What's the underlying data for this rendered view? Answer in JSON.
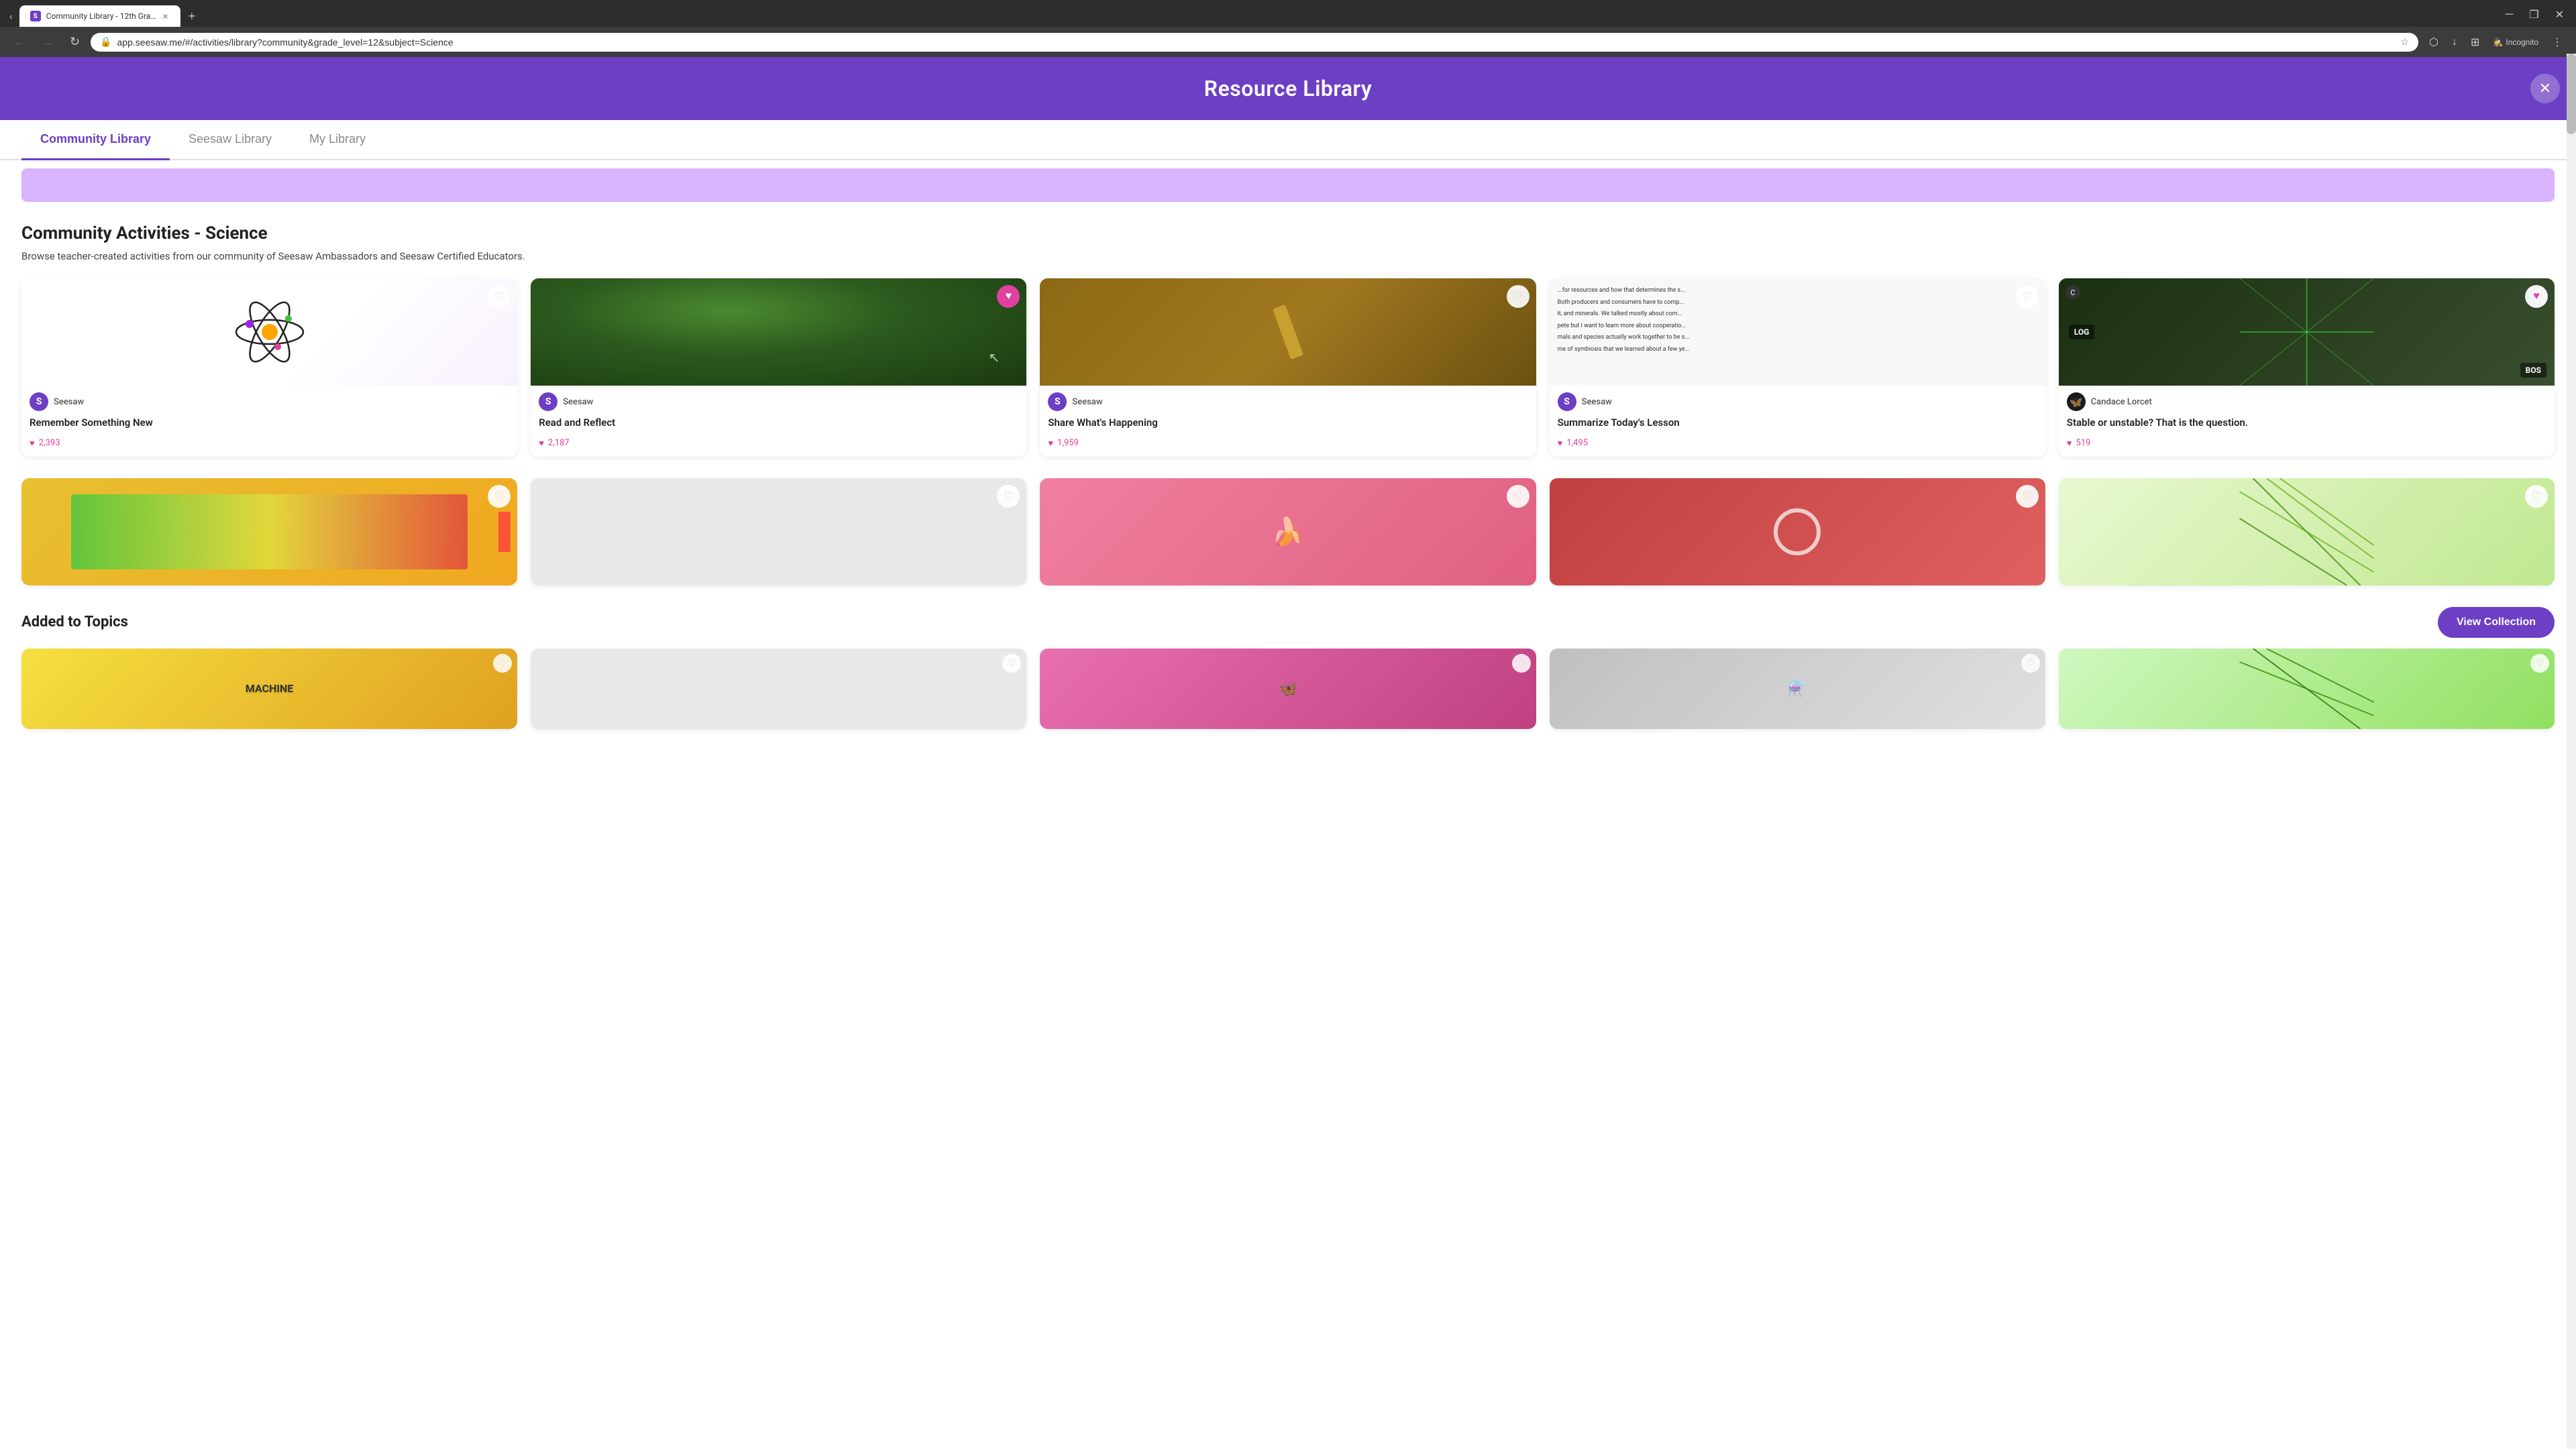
{
  "browser": {
    "tab": {
      "favicon": "S",
      "title": "Community Library - 12th Grad...",
      "close_label": "×"
    },
    "new_tab_label": "+",
    "window_controls": {
      "minimize": "─",
      "maximize": "❐",
      "close": "✕"
    },
    "nav": {
      "back": "←",
      "forward": "→",
      "refresh": "↻"
    },
    "address": "app.seesaw.me/#/activities/library?community&grade_level=12&subject=Science",
    "toolbar": {
      "bookmark": "☆",
      "extensions": "⬡",
      "downloads": "↓",
      "tab_layout": "⊞",
      "profile": "👤",
      "incognito": "Incognito",
      "menu": "⋮"
    }
  },
  "header": {
    "title": "Resource Library",
    "close_label": "✕"
  },
  "tabs": [
    {
      "id": "community",
      "label": "Community Library",
      "active": true
    },
    {
      "id": "seesaw",
      "label": "Seesaw Library",
      "active": false
    },
    {
      "id": "my",
      "label": "My Library",
      "active": false
    }
  ],
  "section": {
    "title": "Community Activities - Science",
    "description": "Browse teacher-created activities from our community of Seesaw Ambassadors and Seesaw Certified Educators."
  },
  "activities": [
    {
      "id": "remember-something-new",
      "author": "Seesaw",
      "author_initial": "S",
      "title": "Remember Something New",
      "likes": "2,393",
      "liked": false,
      "img_type": "atom"
    },
    {
      "id": "read-and-reflect",
      "author": "Seesaw",
      "author_initial": "S",
      "title": "Read and Reflect",
      "likes": "2,187",
      "liked": true,
      "img_type": "plant",
      "hovering": true
    },
    {
      "id": "share-whats-happening",
      "author": "Seesaw",
      "author_initial": "S",
      "title": "Share What's Happening",
      "likes": "1,959",
      "liked": false,
      "img_type": "lab"
    },
    {
      "id": "summarize-todays-lesson",
      "author": "Seesaw",
      "author_initial": "S",
      "title": "Summarize Today's Lesson",
      "likes": "1,495",
      "liked": false,
      "img_type": "text"
    },
    {
      "id": "stable-or-unstable",
      "author": "Candace Lorcet",
      "author_initial": "C",
      "title": "Stable or unstable? That is the question.",
      "likes": "519",
      "liked": true,
      "img_type": "sports"
    }
  ],
  "second_row_cards": [
    {
      "img_type": "yellow",
      "has_heart": true,
      "has_badge": true
    },
    {
      "img_type": "empty",
      "has_heart": true
    },
    {
      "img_type": "pink",
      "has_heart": true
    },
    {
      "img_type": "circuit",
      "has_heart": true
    },
    {
      "img_type": "lines",
      "has_heart": true
    }
  ],
  "added_section": {
    "title": "Added to Topics",
    "view_collection_label": "View Collection"
  },
  "bottom_cards": [
    {
      "img_type": "machine",
      "label": "MACHINE"
    },
    {
      "img_type": "empty"
    },
    {
      "img_type": "pink2"
    },
    {
      "img_type": "circuit2"
    },
    {
      "img_type": "lines2"
    }
  ]
}
